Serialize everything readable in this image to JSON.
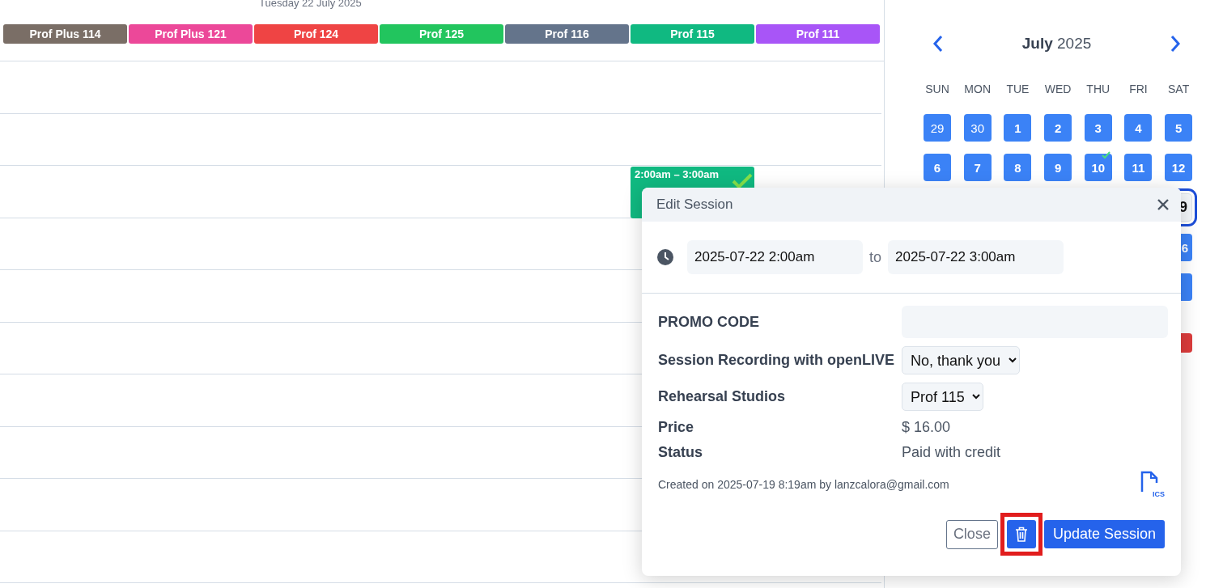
{
  "date_title": "Tuesday 22 July 2025",
  "resources": [
    {
      "name": "Prof Plus 114",
      "color": "#7a6e66"
    },
    {
      "name": "Prof Plus 121",
      "color": "#ec4899"
    },
    {
      "name": "Prof 124",
      "color": "#ef4444"
    },
    {
      "name": "Prof 125",
      "color": "#22c55e"
    },
    {
      "name": "Prof 116",
      "color": "#64748b"
    },
    {
      "name": "Prof 115",
      "color": "#10b981",
      "events": [
        {
          "time": "2:00am – 3:00am",
          "confirmed": true
        }
      ]
    },
    {
      "name": "Prof 111",
      "color": "#a855f7"
    }
  ],
  "mini_calendar": {
    "month": "July",
    "year": "2025",
    "weekdays": [
      "SUN",
      "MON",
      "TUE",
      "WED",
      "THU",
      "FRI",
      "SAT"
    ],
    "weeks": [
      [
        {
          "day": "29",
          "outside": true,
          "selected": false
        },
        {
          "day": "30",
          "outside": true,
          "selected": false
        },
        {
          "day": "1",
          "outside": false,
          "selected": false
        },
        {
          "day": "2",
          "outside": false,
          "selected": false
        },
        {
          "day": "3",
          "outside": false,
          "selected": false
        },
        {
          "day": "4",
          "outside": false,
          "selected": false
        },
        {
          "day": "5",
          "outside": false,
          "selected": false
        }
      ],
      [
        {
          "day": "6",
          "outside": false,
          "selected": false
        },
        {
          "day": "7",
          "outside": false,
          "selected": false
        },
        {
          "day": "8",
          "outside": false,
          "selected": false
        },
        {
          "day": "9",
          "outside": false,
          "selected": false
        },
        {
          "day": "10",
          "outside": false,
          "selected": false,
          "checked": true
        },
        {
          "day": "11",
          "outside": false,
          "selected": false
        },
        {
          "day": "12",
          "outside": false,
          "selected": false
        }
      ],
      [
        {
          "day": "9",
          "selected": true
        }
      ],
      [
        {
          "day": "6",
          "selected": false
        }
      ],
      [
        {
          "selected": false
        }
      ]
    ]
  },
  "modal": {
    "title": "Edit Session",
    "start": "2025-07-22 2:00am",
    "separator": "to",
    "end": "2025-07-22 3:00am",
    "fields": [
      {
        "label": "PROMO CODE",
        "kind": "input"
      },
      {
        "label": "Session Recording with openLIVE",
        "kind": "select",
        "value": "No, thank you"
      },
      {
        "label": "Rehearsal Studios",
        "kind": "select",
        "value": "Prof 115"
      },
      {
        "label": "Price",
        "kind": "text",
        "value": "$ 16.00"
      },
      {
        "label": "Status",
        "kind": "text",
        "value": "Paid with credit"
      }
    ],
    "created": "Created on 2025-07-19 8:19am by lanzcalora@gmail.com",
    "ics_label": "ICS",
    "buttons": [
      {
        "label": "Close",
        "kind": "outline"
      },
      {
        "kind": "delete",
        "highlighted": true
      },
      {
        "label": "Update Session",
        "kind": "primary"
      }
    ]
  }
}
